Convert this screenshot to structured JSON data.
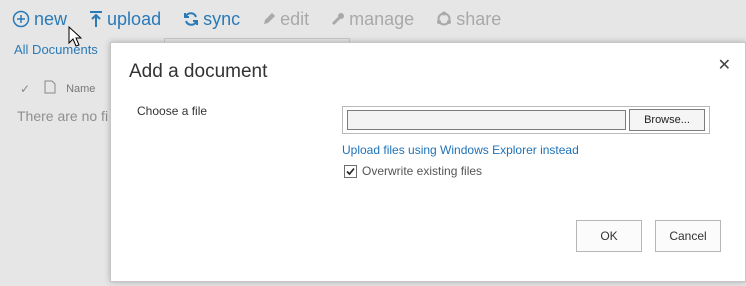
{
  "ribbon": {
    "new_label": "new",
    "upload_label": "upload",
    "sync_label": "sync",
    "edit_label": "edit",
    "manage_label": "manage",
    "share_label": "share"
  },
  "views": {
    "all_documents": "All Documents"
  },
  "list": {
    "name_header": "Name",
    "empty_text": "There are no fi"
  },
  "dialog": {
    "title": "Add a document",
    "close_glyph": "✕",
    "choose_label": "Choose a file",
    "browse_label": "Browse...",
    "explorer_link": "Upload files using Windows Explorer instead",
    "overwrite_label": "Overwrite existing files",
    "overwrite_checked": true,
    "ok_label": "OK",
    "cancel_label": "Cancel"
  },
  "colors": {
    "accent": "#2a7ab8",
    "disabled": "#a9a9a9",
    "link": "#1e72b8"
  }
}
